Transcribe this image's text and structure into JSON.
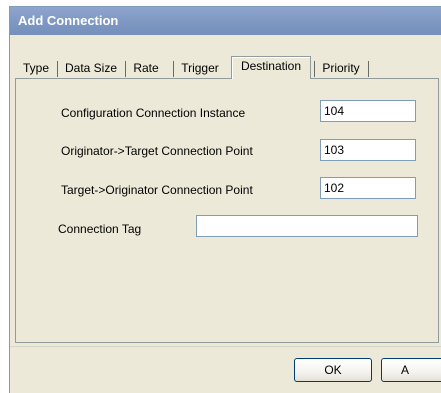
{
  "window": {
    "title": "Add Connection"
  },
  "tabs": [
    {
      "label": "Type"
    },
    {
      "label": "Data Size"
    },
    {
      "label": "Rate"
    },
    {
      "label": "Trigger"
    },
    {
      "label": "Destination",
      "active": true
    },
    {
      "label": "Priority"
    }
  ],
  "form": {
    "config_instance": {
      "label": "Configuration Connection Instance",
      "value": "104"
    },
    "o_to_t_point": {
      "label": "Originator->Target Connection Point",
      "value": "103"
    },
    "t_to_o_point": {
      "label": "Target->Originator Connection Point",
      "value": "102"
    },
    "connection_tag": {
      "label": "Connection Tag",
      "value": ""
    }
  },
  "buttons": {
    "ok": "OK",
    "apply_partial": "A"
  }
}
